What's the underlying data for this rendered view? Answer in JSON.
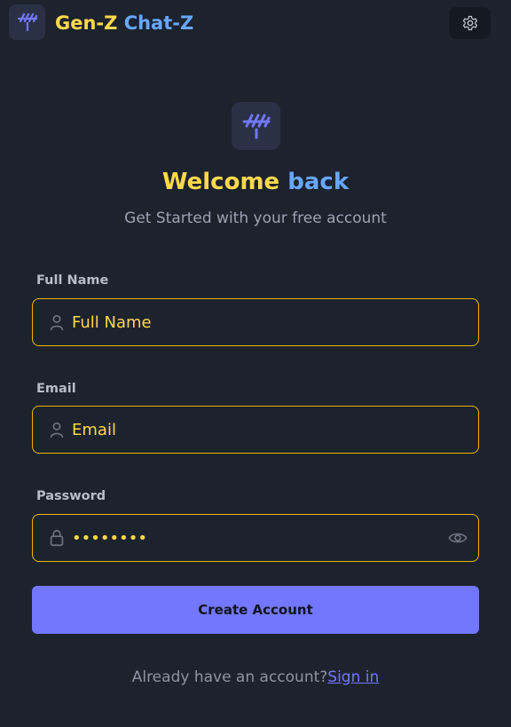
{
  "app": {
    "brand": {
      "gen": "Gen-Z",
      "chat": "Chat-Z"
    },
    "logo_icon": "hash-tally-logo-icon",
    "settings_icon": "gear-icon"
  },
  "hero": {
    "logo_icon": "hash-tally-logo-icon",
    "title_part1": "Welcome",
    "title_part2": "back",
    "subtitle": "Get Started with your free account"
  },
  "form": {
    "full_name": {
      "label": "Full Name",
      "placeholder": "Full Name",
      "value": "",
      "icon": "user-icon"
    },
    "email": {
      "label": "Email",
      "placeholder": "Email",
      "value": "",
      "icon": "user-icon"
    },
    "password": {
      "label": "Password",
      "value": "••••••••",
      "icon": "lock-icon",
      "toggle_icon": "eye-icon"
    },
    "submit_label": "Create Account"
  },
  "footer": {
    "prompt": "Already have an account?",
    "link": "Sign in"
  },
  "colors": {
    "background": "#1d232d",
    "yellow": "#ffd94c",
    "blue": "#67a7ff",
    "button": "#7377ff",
    "border": "#e7b800"
  }
}
